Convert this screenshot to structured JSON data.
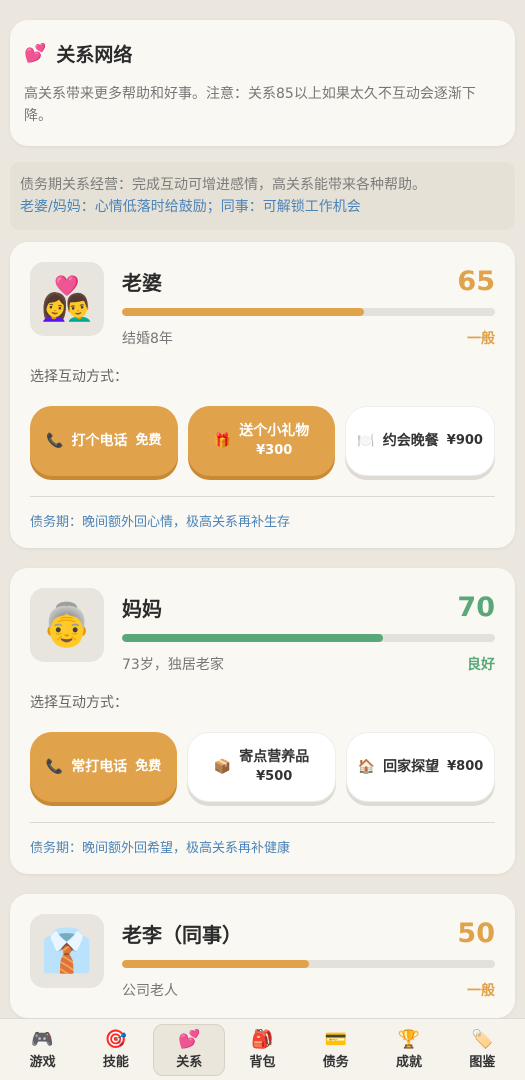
{
  "intro": {
    "icon": "heart-icon",
    "title": "关系网络",
    "desc": "高关系带来更多帮助和好事。注意：关系85以上如果太久不互动会逐渐下降。"
  },
  "tip": {
    "line1": "债务期关系经营：完成互动可增进感情，高关系能带来各种帮助。",
    "line2": "老婆/妈妈：心情低落时给鼓励；同事：可解锁工作机会"
  },
  "colors": {
    "gold": "#e0a24a",
    "green": "#5aa77a",
    "blue": "#4c84b8"
  },
  "people": [
    {
      "avatar": "couple-emoji",
      "name": "老婆",
      "score": "65",
      "score_value": 65,
      "sub": "结婚8年",
      "level": "一般",
      "color": "#e0a24a",
      "choose": "选择互动方式：",
      "actions": [
        {
          "icon": "phone-icon",
          "label": "打个电话",
          "price": "免费",
          "style": "gold"
        },
        {
          "icon": "gift-icon",
          "label": "送个小礼物",
          "price": "¥300",
          "style": "gold"
        },
        {
          "icon": "dinner-icon",
          "label": "约会晚餐",
          "price": "¥900",
          "style": "white"
        }
      ],
      "note": "债务期：晚间额外回心情，极高关系再补生存"
    },
    {
      "avatar": "grandma-emoji",
      "name": "妈妈",
      "score": "70",
      "score_value": 70,
      "sub": "73岁，独居老家",
      "level": "良好",
      "color": "#5aa77a",
      "choose": "选择互动方式：",
      "actions": [
        {
          "icon": "phone-icon",
          "label": "常打电话",
          "price": "免费",
          "style": "gold"
        },
        {
          "icon": "package-icon",
          "label": "寄点营养品",
          "price": "¥500",
          "style": "white"
        },
        {
          "icon": "home-icon",
          "label": "回家探望",
          "price": "¥800",
          "style": "white"
        }
      ],
      "note": "债务期：晚间额外回希望，极高关系再补健康"
    },
    {
      "avatar": "shirt-tie-emoji",
      "name": "老李（同事）",
      "score": "50",
      "score_value": 50,
      "sub": "公司老人",
      "level": "一般",
      "color": "#e0a24a"
    }
  ],
  "nav": [
    {
      "icon": "gamepad-icon",
      "label": "游戏",
      "active": false
    },
    {
      "icon": "target-icon",
      "label": "技能",
      "active": false
    },
    {
      "icon": "heart-icon",
      "label": "关系",
      "active": true
    },
    {
      "icon": "backpack-icon",
      "label": "背包",
      "active": false
    },
    {
      "icon": "card-icon",
      "label": "债务",
      "active": false
    },
    {
      "icon": "trophy-icon",
      "label": "成就",
      "active": false
    },
    {
      "icon": "tag-icon",
      "label": "图鉴",
      "active": false
    }
  ]
}
